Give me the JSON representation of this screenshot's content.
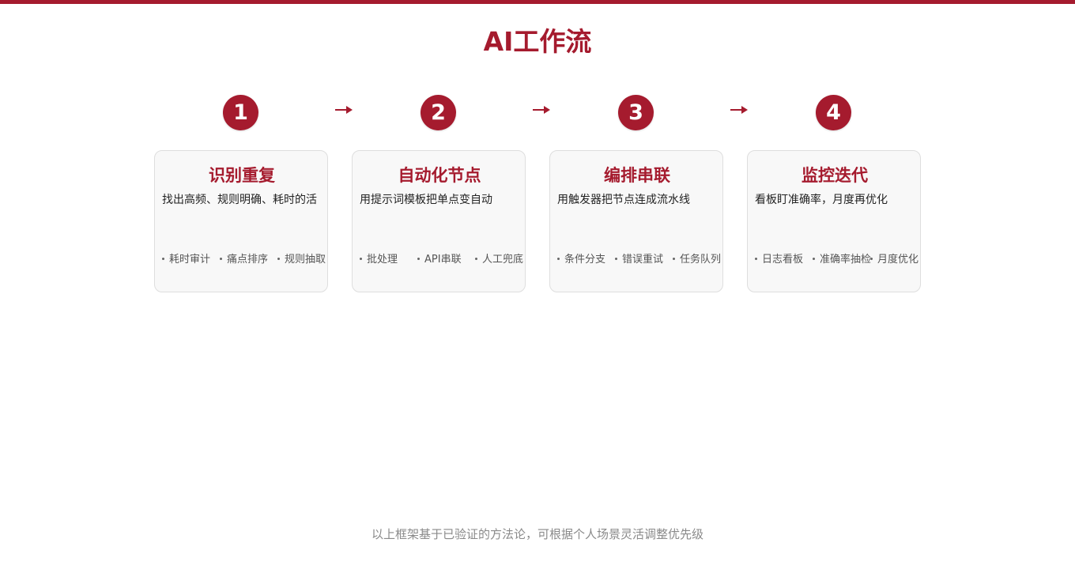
{
  "title": "AI工作流",
  "accent_color": "#a51b2e",
  "steps": [
    {
      "number": "1",
      "title": "识别重复",
      "description": "找出高频、规则明确、耗时的活",
      "tags": [
        "耗时审计",
        "痛点排序",
        "规则抽取"
      ]
    },
    {
      "number": "2",
      "title": "自动化节点",
      "description": "用提示词模板把单点变自动",
      "tags": [
        "批处理",
        "API串联",
        "人工兜底"
      ]
    },
    {
      "number": "3",
      "title": "编排串联",
      "description": "用触发器把节点连成流水线",
      "tags": [
        "条件分支",
        "错误重试",
        "任务队列"
      ]
    },
    {
      "number": "4",
      "title": "监控迭代",
      "description": "看板盯准确率，月度再优化",
      "tags": [
        "日志看板",
        "准确率抽检",
        "月度优化"
      ]
    }
  ],
  "footer": "以上框架基于已验证的方法论，可根据个人场景灵活调整优先级"
}
